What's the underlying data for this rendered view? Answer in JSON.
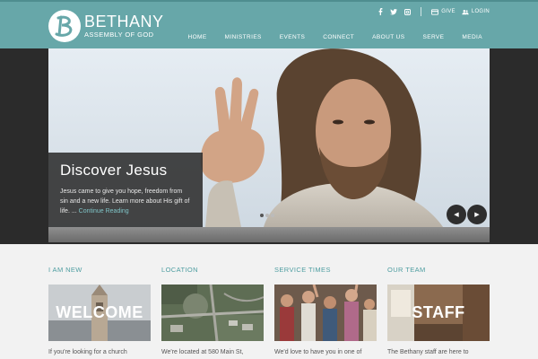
{
  "brand": {
    "name": "BETHANY",
    "subtitle": "ASSEMBLY OF GOD"
  },
  "utility": {
    "give_label": "GIVE",
    "login_label": "LOGIN",
    "social": [
      "facebook-icon",
      "twitter-icon",
      "instagram-icon"
    ]
  },
  "nav": {
    "items": [
      "HOME",
      "MINISTRIES",
      "EVENTS",
      "CONNECT",
      "ABOUT US",
      "SERVE",
      "MEDIA"
    ]
  },
  "hero": {
    "title": "Discover Jesus",
    "text": "Jesus came to give you hope, freedom from sin and a new life. Learn more about His gift of life. ...",
    "more_label": "Continue Reading",
    "prev_label": "◀",
    "next_label": "▶",
    "slide_count": 3,
    "active_slide": 1
  },
  "columns": [
    {
      "title": "I AM NEW",
      "image_label": "WELCOME",
      "text": "If you're looking for a church"
    },
    {
      "title": "LOCATION",
      "image_label": "",
      "text": "We're located at 580 Main St,"
    },
    {
      "title": "SERVICE TIMES",
      "image_label": "",
      "text": "We'd love to have you in one of"
    },
    {
      "title": "OUR TEAM",
      "image_label": "STAFF",
      "text": "The Bethany staff are here to"
    }
  ],
  "colors": {
    "header": "#67a7a9",
    "accent": "#4f9ea1",
    "hero_band": "#2b2b2b"
  }
}
